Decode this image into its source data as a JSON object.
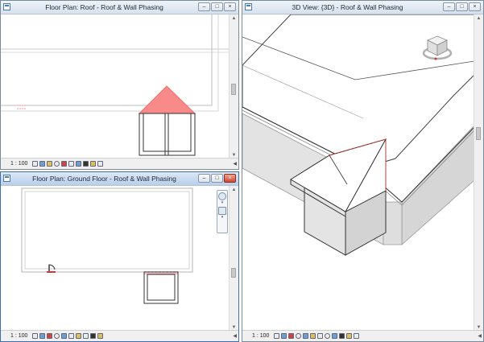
{
  "windows": {
    "roof_plan": {
      "title": "Floor Plan: Roof - Roof & Wall Phasing",
      "scale": "1 : 100",
      "buttons": {
        "minimize": "–",
        "maximize": "□",
        "close": "×"
      }
    },
    "ground_plan": {
      "title": "Floor Plan: Ground Floor - Roof & Wall Phasing",
      "scale": "1 : 100",
      "buttons": {
        "minimize": "–",
        "maximize": "□",
        "close": "×"
      }
    },
    "view_3d": {
      "title": "3D View: {3D} - Roof & Wall Phasing",
      "scale": "1 : 100",
      "buttons": {
        "minimize": "–",
        "maximize": "□",
        "close": "×"
      }
    }
  },
  "colors": {
    "highlight_fill": "#f98a8a",
    "highlight_line": "#e03030",
    "wall_gray": "#e3e3e3",
    "wall_gray_dark": "#d4d4d4",
    "titlebar_active": "#b9cfe9",
    "close_red": "#cf4a32"
  },
  "icons": [
    "view-app-icon",
    "minimize-icon",
    "maximize-icon",
    "close-icon",
    "view-cube-icon",
    "zoom-icon",
    "pan-icon",
    "scroll-up-icon",
    "scroll-down-icon"
  ]
}
